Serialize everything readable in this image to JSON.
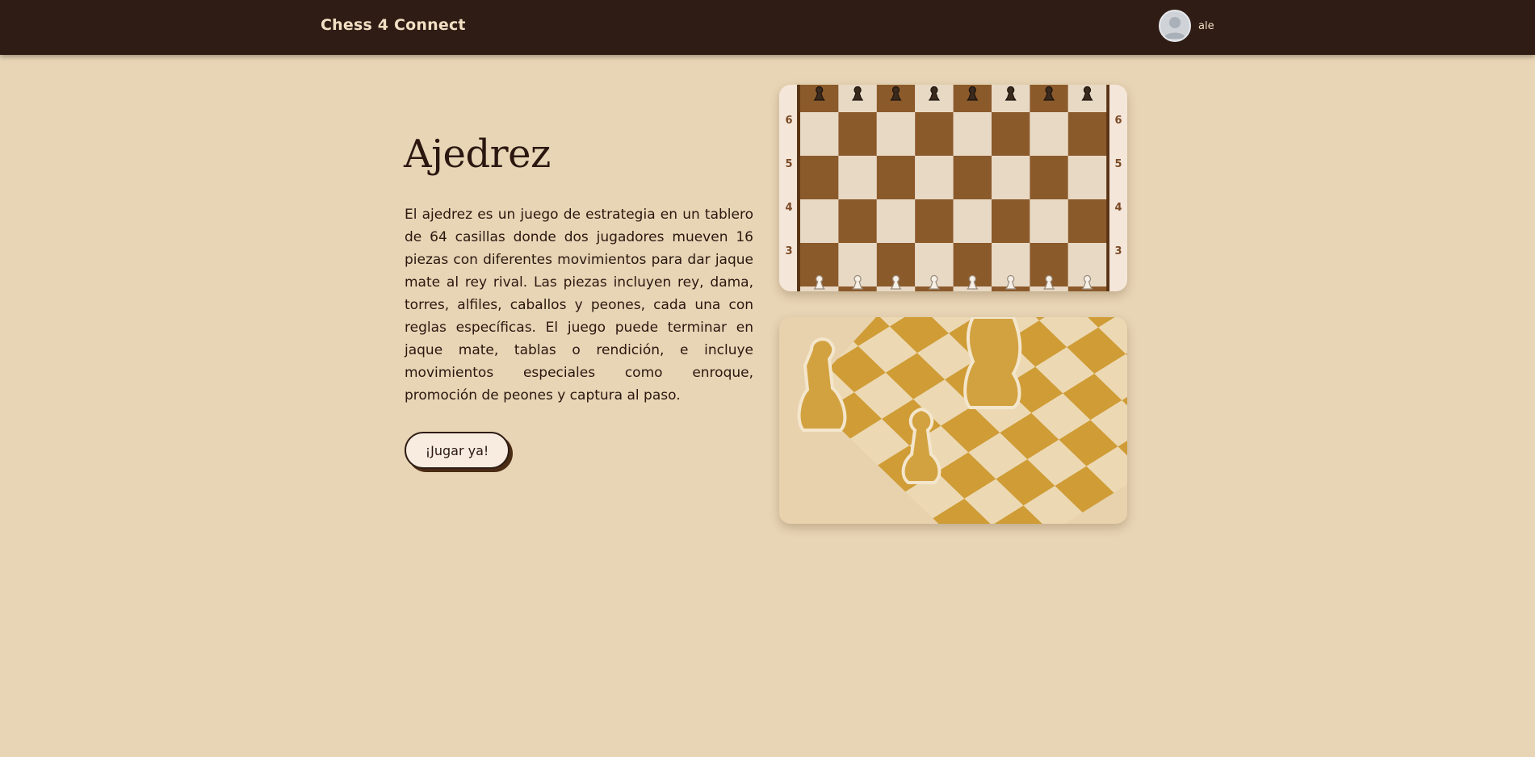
{
  "header": {
    "brand": "Chess 4 Connect",
    "username": "ale",
    "avatar_icon": "user-avatar-icon"
  },
  "main": {
    "title": "Ajedrez",
    "description": "El ajedrez es un juego de estrategia en un tablero de 64 casillas donde dos jugadores mueven 16 piezas con diferentes movimientos para dar jaque mate al rey rival. Las piezas incluyen rey, dama, torres, alfiles, caballos y peones, cada una con reglas específicas. El juego puede terminar en jaque mate, tablas o rendición, e incluye movimientos especiales como enroque, promoción de peones y captura al paso.",
    "play_button": "¡Jugar ya!"
  },
  "board_image": {
    "rank_labels": [
      "6",
      "5",
      "4",
      "3"
    ],
    "pawn_icon": "pawn-icon"
  },
  "colors": {
    "header_bg": "#2e1c15",
    "page_bg": "#e8d5b5",
    "dark_square": "#8b5a2b",
    "light_square": "#e8d9c5",
    "accent_text": "#f3dfc3"
  }
}
